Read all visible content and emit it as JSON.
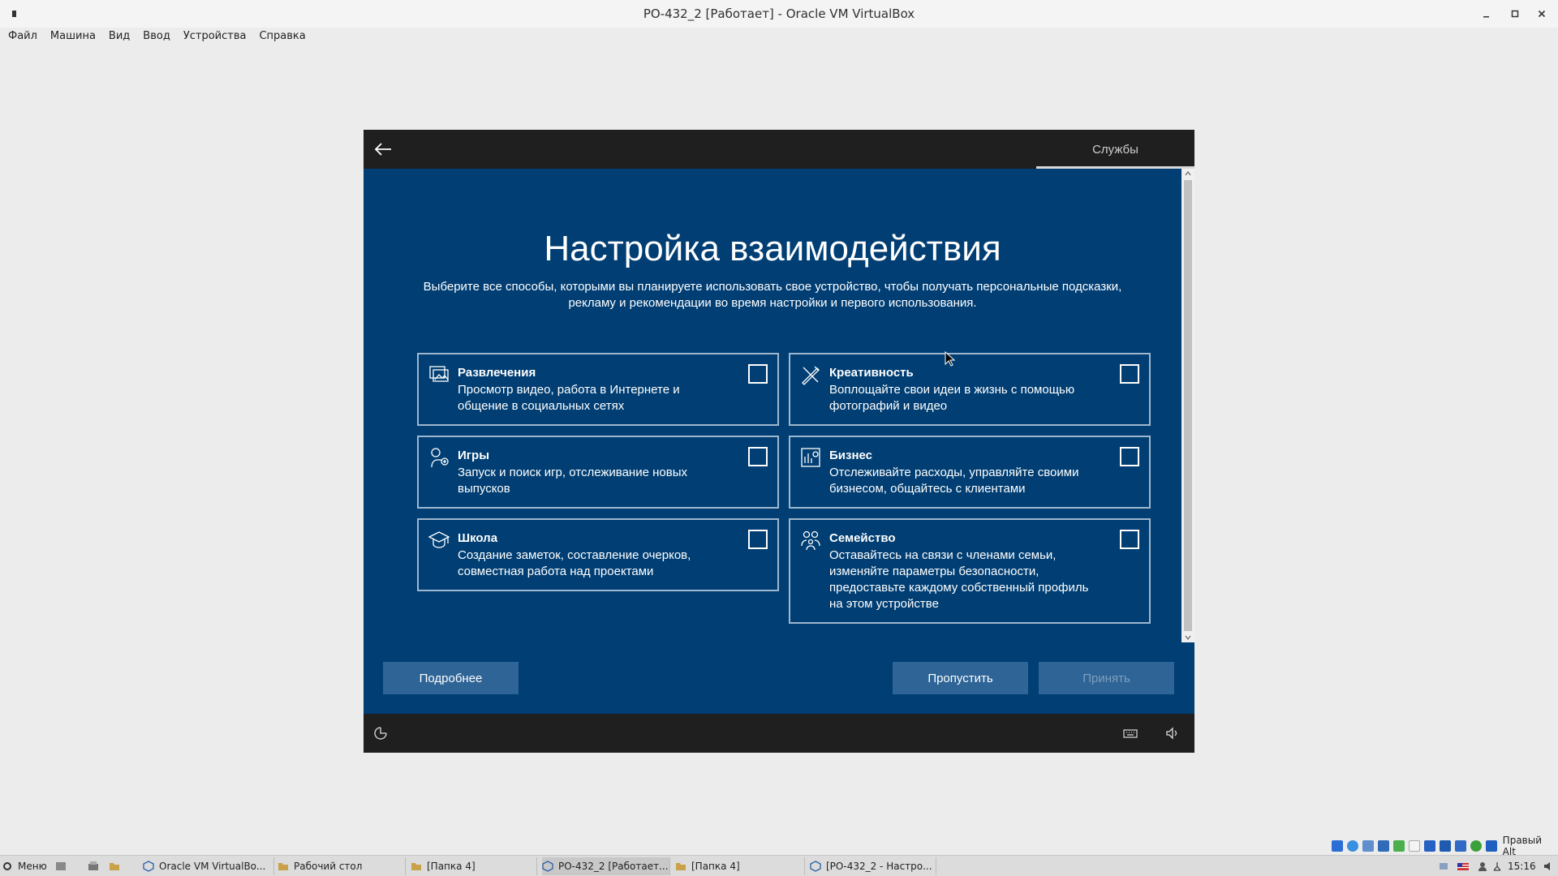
{
  "window": {
    "title": "РО-432_2 [Работает] - Oracle VM VirtualBox"
  },
  "menu": [
    "Файл",
    "Машина",
    "Вид",
    "Ввод",
    "Устройства",
    "Справка"
  ],
  "oobe": {
    "tab_label": "Службы",
    "heading": "Настройка взаимодействия",
    "subtitle": "Выберите все способы, которыми вы планируете использовать свое устройство, чтобы получать персональные подсказки, рекламу и рекомендации во время настройки и первого использования.",
    "cards": [
      {
        "title": "Развлечения",
        "desc": "Просмотр видео, работа в Интернете и общение в социальных сетях",
        "icon": "entertainment-icon",
        "checked": false
      },
      {
        "title": "Креативность",
        "desc": "Воплощайте свои идеи в жизнь с помощью фотографий и видео",
        "icon": "creativity-icon",
        "checked": false
      },
      {
        "title": "Игры",
        "desc": "Запуск и поиск игр, отслеживание новых выпусков",
        "icon": "gaming-icon",
        "checked": false
      },
      {
        "title": "Бизнес",
        "desc": "Отслеживайте расходы, управляйте своими бизнесом, общайтесь с клиентами",
        "icon": "business-icon",
        "checked": false
      },
      {
        "title": "Школа",
        "desc": "Создание заметок, составление очерков, совместная работа над проектами",
        "icon": "school-icon",
        "checked": false
      },
      {
        "title": "Семейство",
        "desc": "Оставайтесь на связи с членами семьи, изменяйте параметры безопасности, предоставьте каждому собственный профиль на этом устройстве",
        "icon": "family-icon",
        "checked": false
      }
    ],
    "buttons": {
      "more": "Подробнее",
      "skip": "Пропустить",
      "accept": "Принять"
    }
  },
  "taskbar": {
    "menu_label": "Меню",
    "tasks": [
      "Oracle VM VirtualBo...",
      "Рабочий стол",
      "[Папка 4]",
      "РО-432_2 [Работает...",
      "[Папка 4]",
      "[РО-432_2 - Настро..."
    ],
    "clock": "15:16",
    "host_key": "Правый Alt"
  },
  "colors": {
    "oobe_bg": "#003e73",
    "button_bg": "#2e6496",
    "bar_bg": "#1f1f1f"
  }
}
